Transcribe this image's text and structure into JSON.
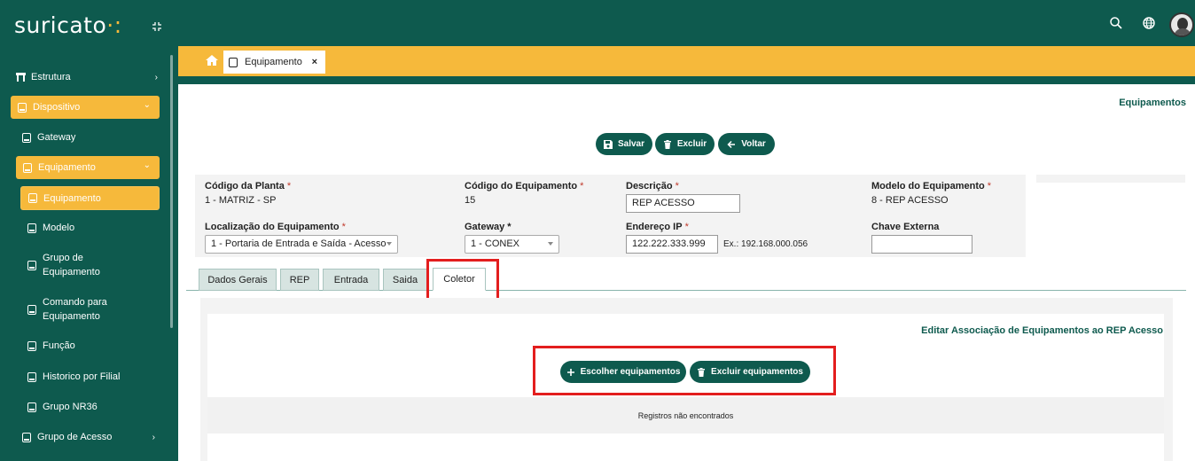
{
  "app": {
    "logo": "suricato",
    "logo_dot": "·:"
  },
  "sidebar": {
    "items": [
      {
        "label": "Estrutura",
        "arrow": "›"
      },
      {
        "label": "Dispositivo",
        "arrow": "⌄"
      },
      {
        "label": "Gateway"
      },
      {
        "label": "Equipamento",
        "arrow": "⌄"
      },
      {
        "label": "Equipamento"
      },
      {
        "label": "Modelo"
      },
      {
        "label": "Grupo de Equipamento"
      },
      {
        "label": "Comando para Equipamento"
      },
      {
        "label": "Função"
      },
      {
        "label": "Historico por Filial"
      },
      {
        "label": "Grupo NR36"
      },
      {
        "label": "Grupo de Acesso",
        "arrow": "›"
      }
    ]
  },
  "tabstrip": {
    "open_tab_label": "Equipamento",
    "close": "×"
  },
  "page": {
    "breadcrumb": "Equipamentos",
    "actions": {
      "save": "Salvar",
      "delete": "Excluir",
      "back": "Voltar"
    },
    "fields": {
      "codigo_planta": {
        "label": "Código da Planta",
        "value": "1 - MATRIZ - SP"
      },
      "codigo_equipamento": {
        "label": "Código do Equipamento",
        "value": "15"
      },
      "descricao": {
        "label": "Descrição",
        "value": "REP ACESSO"
      },
      "modelo": {
        "label": "Modelo do Equipamento",
        "value": "8 - REP ACESSO"
      },
      "localizacao": {
        "label": "Localização do Equipamento",
        "value": "1 - Portaria de Entrada e Saída - Acesso"
      },
      "gateway": {
        "label": "Gateway *",
        "value": "1 - CONEX"
      },
      "endereco_ip": {
        "label": "Endereço IP",
        "value": "122.222.333.999",
        "hint": "Ex.: 192.168.000.056"
      },
      "chave_externa": {
        "label": "Chave Externa",
        "value": ""
      }
    },
    "required_mark": "*",
    "tabs": [
      "Dados Gerais",
      "REP",
      "Entrada",
      "Saida",
      "Coletor"
    ],
    "active_tab": "Coletor",
    "coletor": {
      "title": "Editar Associação de Equipamentos ao REP Acesso",
      "choose_button": "Escolher equipamentos",
      "delete_button": "Excluir equipamentos",
      "empty_message": "Registros não encontrados"
    }
  },
  "colors": {
    "primary": "#0e5a4e",
    "accent": "#f6b93b",
    "highlight": "#e31e1e"
  }
}
